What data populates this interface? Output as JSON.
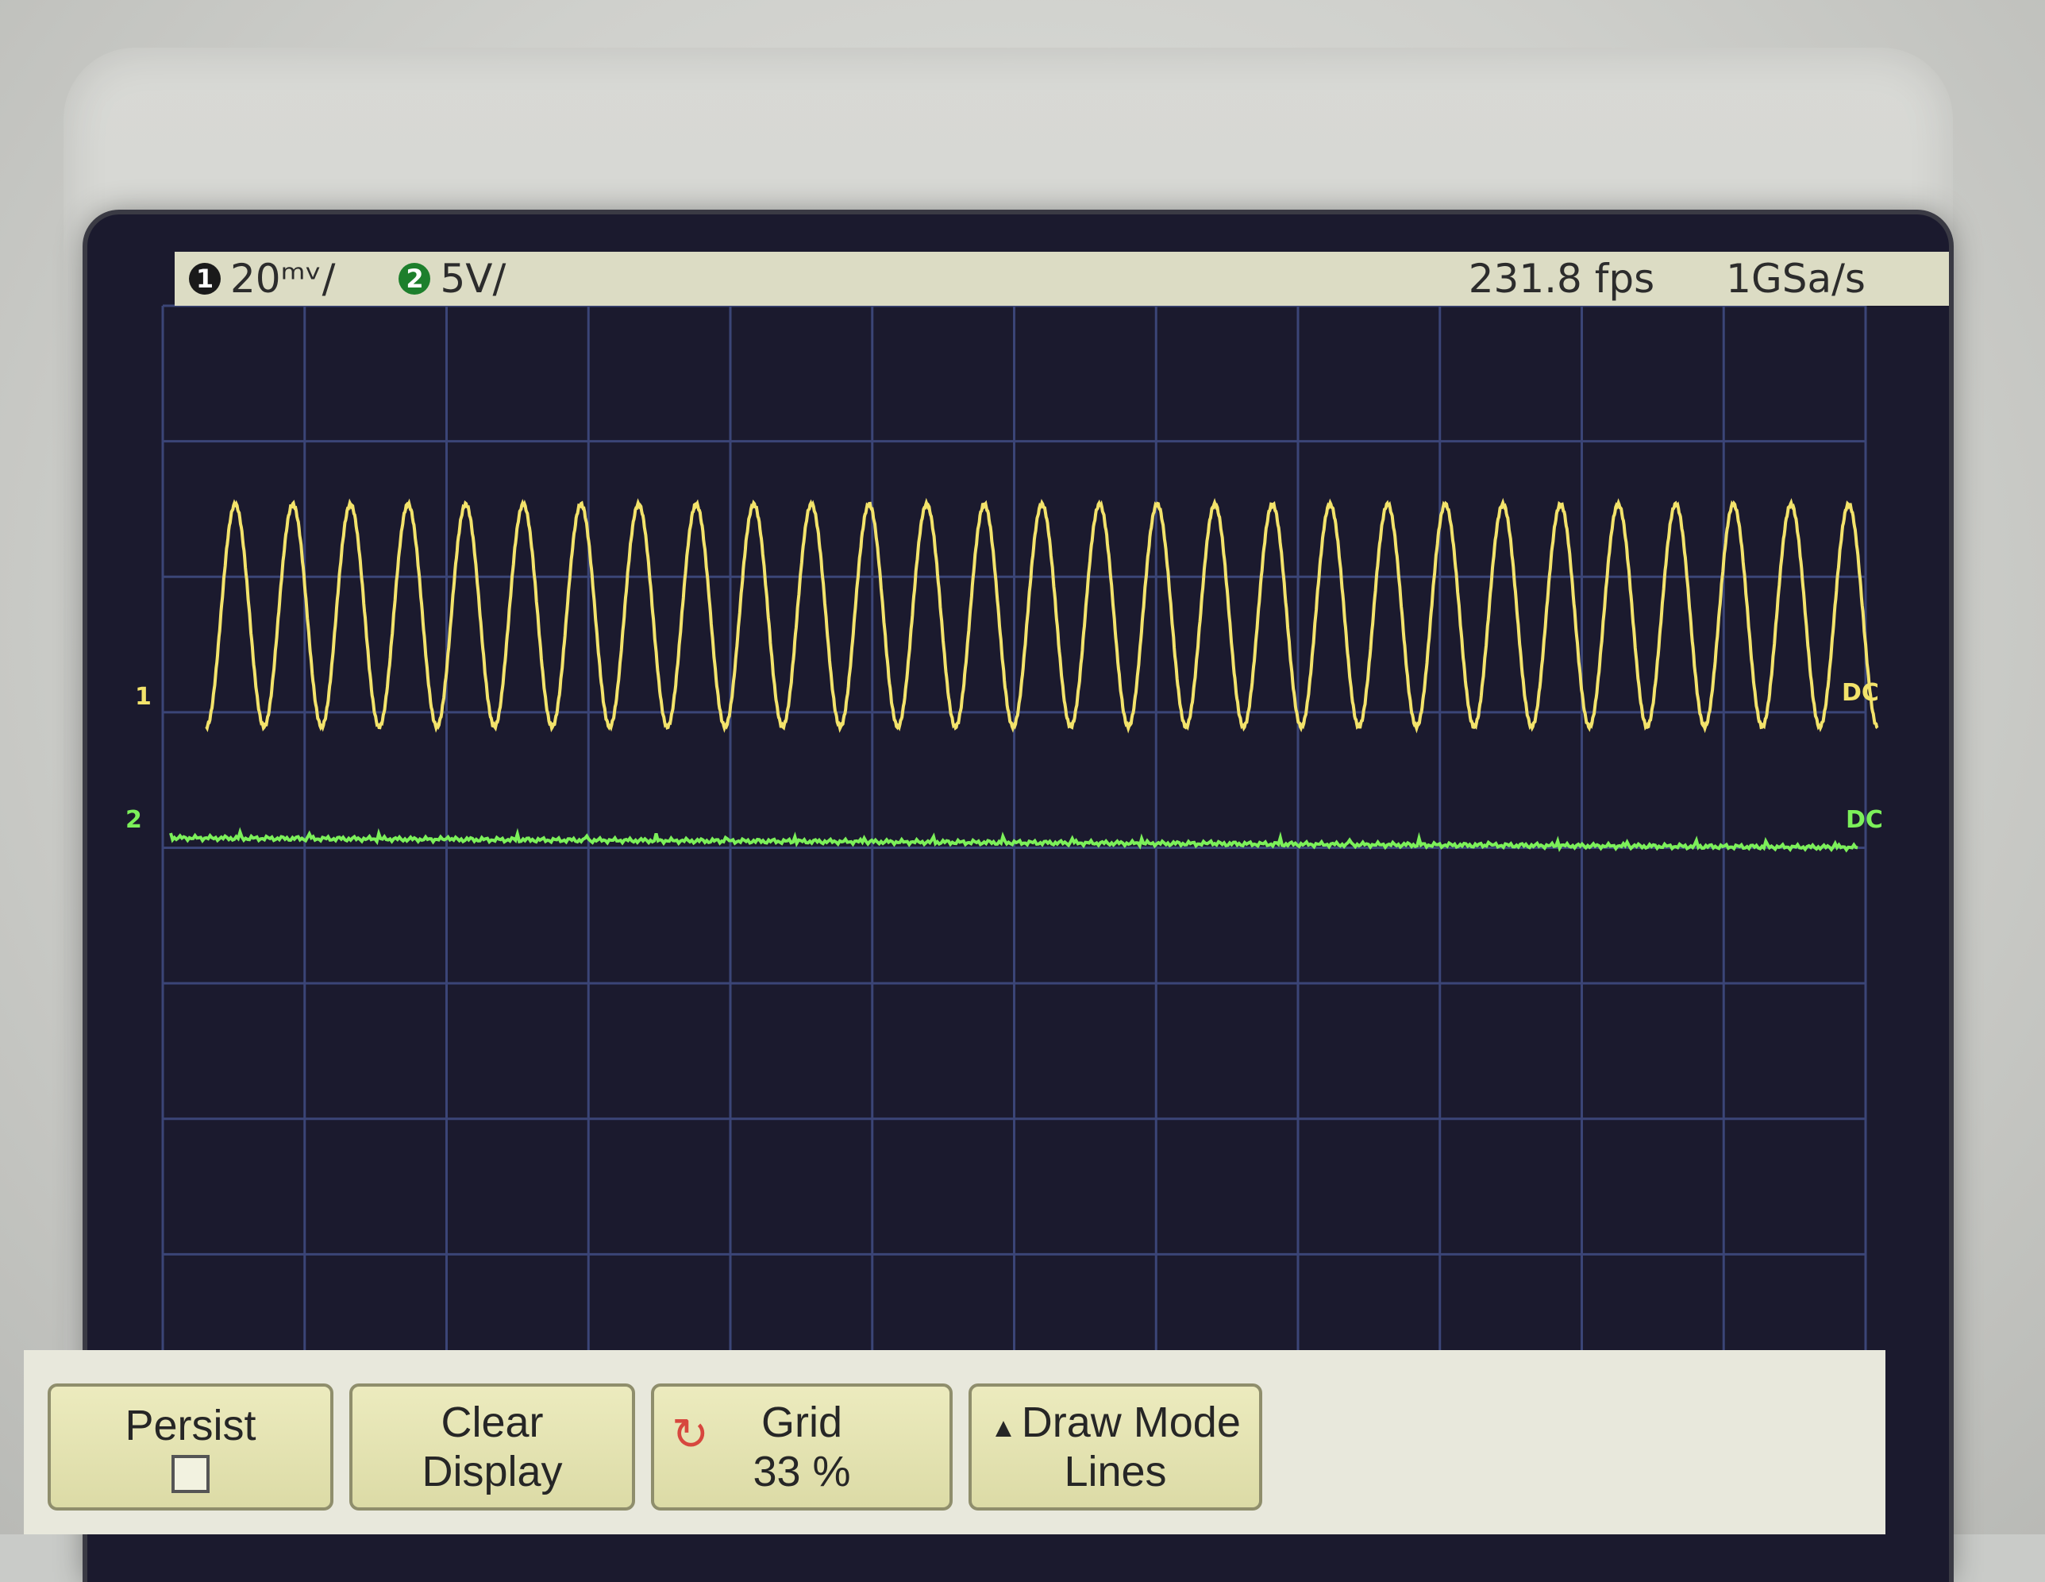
{
  "status": {
    "ch1_number": "1",
    "ch1_scale": "20ᵐᵛ/",
    "ch2_number": "2",
    "ch2_scale": "5V/",
    "fps": "231.8 fps",
    "sample_rate": "1GSa/s"
  },
  "markers": {
    "ch1_left": "1",
    "ch1_coupling": "DC",
    "ch2_left": "2",
    "ch2_coupling": "DC"
  },
  "softkeys": {
    "persist_label": "Persist",
    "clear_line1": "Clear",
    "clear_line2": "Display",
    "grid_line1": "Grid",
    "grid_line2": "33 %",
    "draw_mode_line1": "Draw Mode",
    "draw_mode_line2": "Lines"
  },
  "colors": {
    "ch1": "#f3e36b",
    "ch2": "#7cf05a",
    "grid": "#3b4577"
  },
  "chart_data": {
    "type": "line",
    "cycles_visible": 29,
    "series": [
      {
        "name": "1",
        "waveform": "sine"
      },
      {
        "name": "2",
        "waveform": "flat"
      }
    ]
  }
}
